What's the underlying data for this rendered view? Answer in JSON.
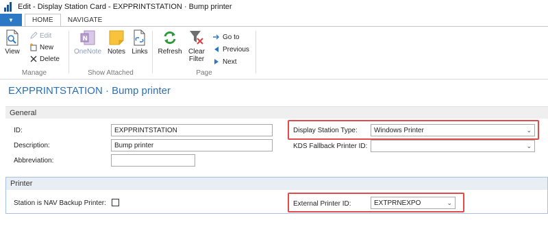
{
  "window": {
    "title": "Edit - Display Station Card - EXPPRINTSTATION · Bump printer"
  },
  "ribbon": {
    "menu_glyph": "▼",
    "tabs": [
      {
        "label": "HOME"
      },
      {
        "label": "NAVIGATE"
      }
    ],
    "groups": {
      "manage": {
        "label": "Manage",
        "view": "View",
        "edit": "Edit",
        "new": "New",
        "delete": "Delete"
      },
      "show_attached": {
        "label": "Show Attached",
        "onenote": "OneNote",
        "notes": "Notes",
        "links": "Links"
      },
      "page": {
        "label": "Page",
        "refresh": "Refresh",
        "clear_filter_line1": "Clear",
        "clear_filter_line2": "Filter",
        "goto": "Go to",
        "previous": "Previous",
        "next": "Next"
      }
    }
  },
  "page": {
    "title": "EXPPRINTSTATION · Bump printer"
  },
  "general": {
    "header": "General",
    "id_label": "ID:",
    "id_value": "EXPPRINTSTATION",
    "description_label": "Description:",
    "description_value": "Bump printer",
    "abbreviation_label": "Abbreviation:",
    "abbreviation_value": "",
    "display_station_type_label": "Display Station Type:",
    "display_station_type_value": "Windows Printer",
    "kds_fallback_label": "KDS Fallback Printer ID:",
    "kds_fallback_value": ""
  },
  "printer": {
    "header": "Printer",
    "nav_backup_label": "Station is NAV Backup Printer:",
    "nav_backup_checked": false,
    "external_printer_label": "External Printer ID:",
    "external_printer_value": "EXTPRNEXPO"
  },
  "colors": {
    "accent": "#2c6fb3",
    "ribbon_menu": "#2b78c5",
    "highlight": "#e14a4a",
    "printer_border": "#a6c1e4"
  }
}
